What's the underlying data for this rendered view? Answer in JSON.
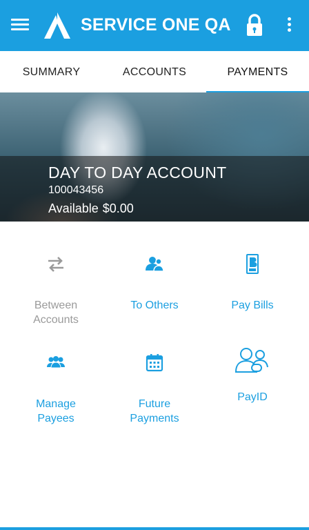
{
  "app": {
    "title": "SERVICE ONE QA"
  },
  "tabs": [
    {
      "label": "SUMMARY"
    },
    {
      "label": "ACCOUNTS"
    },
    {
      "label": "PAYMENTS",
      "active": true
    }
  ],
  "account": {
    "name": "DAY TO DAY ACCOUNT",
    "number": "100043456",
    "available_label": "Available",
    "available_amount": "$0.00"
  },
  "actions": [
    {
      "line1": "Between",
      "line2": "Accounts",
      "icon": "transfer-arrows-icon",
      "enabled": false
    },
    {
      "line1": "To Others",
      "line2": "",
      "icon": "person-transfer-icon",
      "enabled": true
    },
    {
      "line1": "Pay Bills",
      "line2": "",
      "icon": "bpay-icon",
      "enabled": true
    },
    {
      "line1": "Manage",
      "line2": "Payees",
      "icon": "group-icon",
      "enabled": true
    },
    {
      "line1": "Future",
      "line2": "Payments",
      "icon": "calendar-icon",
      "enabled": true
    },
    {
      "line1": "PayID",
      "line2": "",
      "icon": "payid-icon",
      "enabled": true
    }
  ],
  "colors": {
    "accent": "#1b9fe0",
    "disabled": "#9a9a9a"
  }
}
